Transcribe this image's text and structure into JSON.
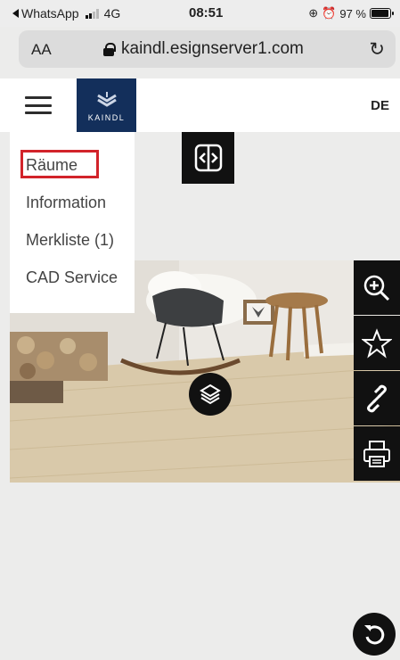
{
  "status_bar": {
    "back_app": "WhatsApp",
    "network": "4G",
    "time": "08:51",
    "battery": "97 %",
    "battery_level": 0.97
  },
  "browser": {
    "text_size_label": "AA",
    "domain": "kaindl.esignserver1.com"
  },
  "header": {
    "logo_text": "KAINDL",
    "language": "DE"
  },
  "menu": {
    "items": [
      {
        "label": "Räume"
      },
      {
        "label": "Information"
      },
      {
        "label": "Merkliste (1)"
      },
      {
        "label": "CAD Service"
      }
    ]
  },
  "icons": {
    "menu": "hamburger-icon",
    "compare": "compare-arrows-icon",
    "layers": "layers-icon",
    "zoom": "zoom-in-icon",
    "favorite": "star-icon",
    "share": "link-icon",
    "print": "printer-icon",
    "undo": "undo-icon",
    "reload": "reload-icon"
  },
  "colors": {
    "brand": "#132f5b",
    "highlight": "#d2232a",
    "toolbar": "#111111",
    "floor": "#d8c8a8"
  }
}
